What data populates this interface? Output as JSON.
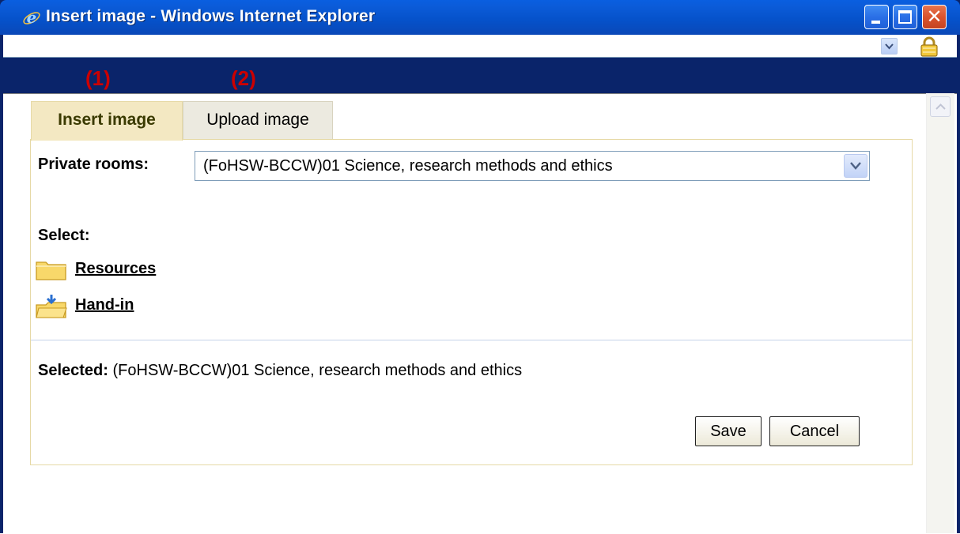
{
  "window": {
    "title": "Insert image - Windows Internet Explorer",
    "icon": "ie-icon",
    "controls": [
      "minimize-icon",
      "maximize-icon",
      "close-icon"
    ]
  },
  "annotations": [
    "(1)",
    "(2)"
  ],
  "tabs": [
    {
      "label": "Insert image",
      "active": true
    },
    {
      "label": "Upload image",
      "active": false
    }
  ],
  "form": {
    "rooms_label": "Private rooms:",
    "rooms_selected": "(FoHSW-BCCW)01 Science, research methods and ethics",
    "select_label": "Select:",
    "folders": [
      {
        "label": "Resources",
        "icon": "folder-icon"
      },
      {
        "label": "Hand-in",
        "icon": "hand-in-folder-icon"
      }
    ],
    "selected_label": "Selected:",
    "selected_value": "(FoHSW-BCCW)01 Science, research methods and ethics"
  },
  "buttons": {
    "save": "Save",
    "cancel": "Cancel"
  },
  "colors": {
    "titlebar": "#0551c9",
    "annotation": "#cc0000",
    "active_tab": "#f3e8c2"
  }
}
